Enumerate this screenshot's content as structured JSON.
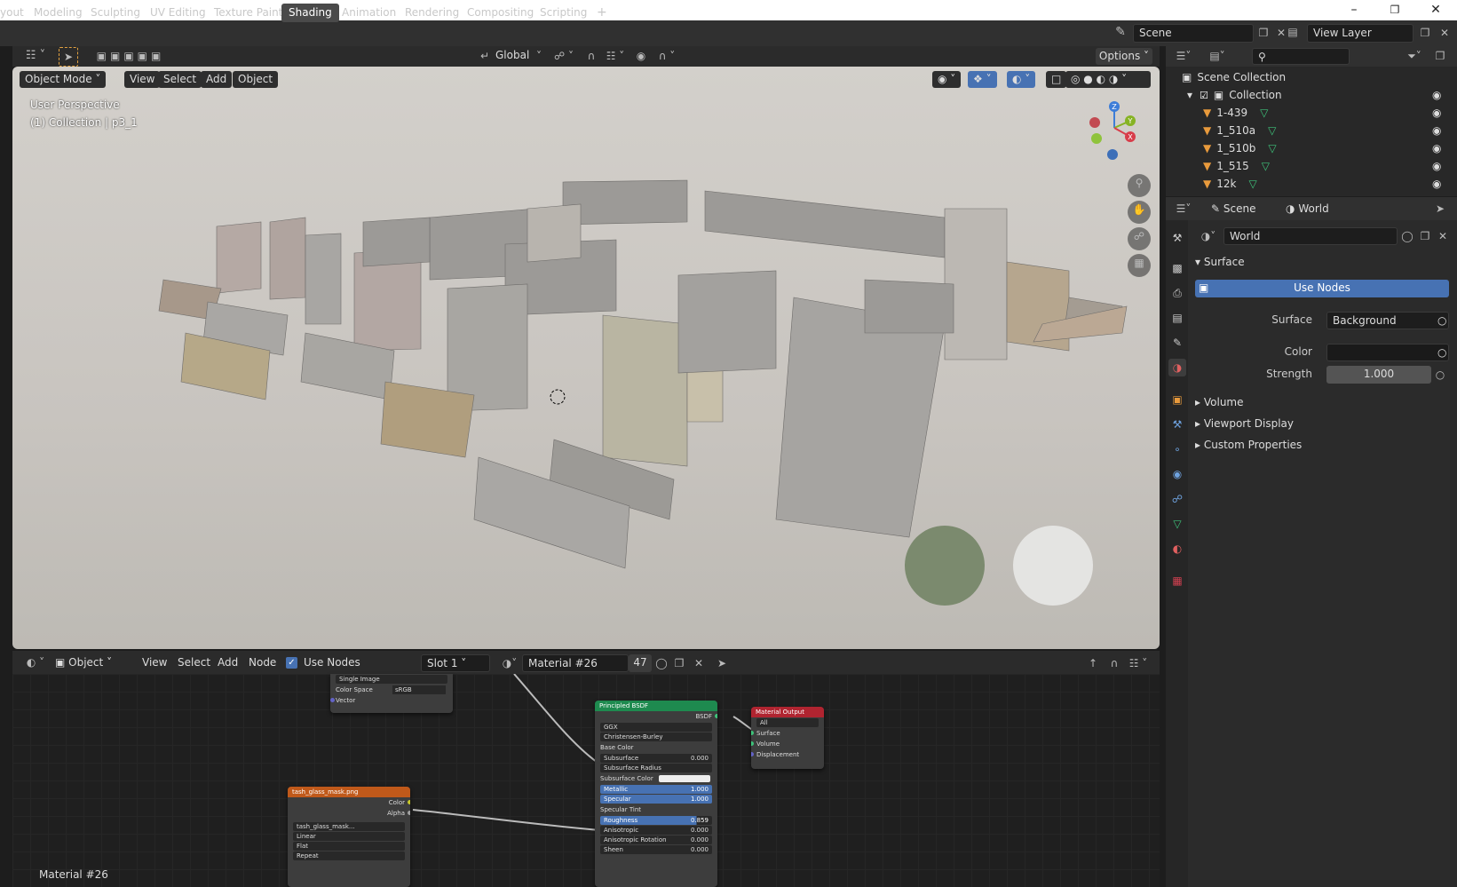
{
  "workspace_tabs": [
    "yout",
    "Modeling",
    "Sculpting",
    "UV Editing",
    "Texture Paint",
    "Shading",
    "Animation",
    "Rendering",
    "Compositing",
    "Scripting",
    "+"
  ],
  "active_workspace": "Shading",
  "scene_name": "Scene",
  "view_layer": "View Layer",
  "viewport": {
    "mode": "Object Mode",
    "menus": [
      "View",
      "Select",
      "Add",
      "Object"
    ],
    "transform_orientation": "Global",
    "options": "Options",
    "perspective_label": "User Perspective",
    "collection_label": "(1) Collection | p3_1",
    "gizmo": {
      "z": "Z",
      "y": "Y",
      "x": "X"
    }
  },
  "node_editor": {
    "editor_type": "Object",
    "menus": [
      "View",
      "Select",
      "Add",
      "Node"
    ],
    "use_nodes_label": "Use Nodes",
    "slot": "Slot 1",
    "material_name": "Material #26",
    "user_count": "47",
    "footer_label": "Material #26",
    "image_node_top": {
      "source": "Single Image",
      "color_space_label": "Color Space",
      "color_space": "sRGB",
      "vector": "Vector"
    },
    "image_node": {
      "title": "tash_glass_mask.png",
      "color": "Color",
      "alpha": "Alpha",
      "file": "tash_glass_mask...",
      "interp": "Linear",
      "proj": "Flat",
      "ext": "Repeat"
    },
    "bsdf": {
      "title": "Principled BSDF",
      "output": "BSDF",
      "distribution": "GGX",
      "subsurface_method": "Christensen-Burley",
      "base_color": "Base Color",
      "subsurface": {
        "label": "Subsurface",
        "value": "0.000"
      },
      "subsurface_radius": "Subsurface Radius",
      "subsurface_color": "Subsurface Color",
      "metallic": {
        "label": "Metallic",
        "value": "1.000"
      },
      "specular": {
        "label": "Specular",
        "value": "1.000"
      },
      "specular_tint": "Specular Tint",
      "roughness": {
        "label": "Roughness",
        "value": "0.859"
      },
      "anisotropic": {
        "label": "Anisotropic",
        "value": "0.000"
      },
      "anisotropic_rotation": {
        "label": "Anisotropic Rotation",
        "value": "0.000"
      },
      "sheen": {
        "label": "Sheen",
        "value": "0.000"
      }
    },
    "output_node": {
      "title": "Material Output",
      "target": "All",
      "surface": "Surface",
      "volume": "Volume",
      "displacement": "Displacement"
    }
  },
  "outliner": {
    "root": "Scene Collection",
    "collection": "Collection",
    "objects": [
      "1-439",
      "1_510a",
      "1_510b",
      "1_515",
      "12k"
    ]
  },
  "properties": {
    "tabs": [
      "Scene",
      "World"
    ],
    "world_name": "World",
    "surface_panel": "Surface",
    "use_nodes": "Use Nodes",
    "surface_label": "Surface",
    "surface_value": "Background",
    "color_label": "Color",
    "strength_label": "Strength",
    "strength_value": "1.000",
    "panels": [
      "Volume",
      "Viewport Display",
      "Custom Properties"
    ]
  },
  "colors": {
    "accent": "#4772b3",
    "bsdf_header": "#1e8a4f",
    "image_header": "#c0591a",
    "output_header": "#b02430"
  }
}
